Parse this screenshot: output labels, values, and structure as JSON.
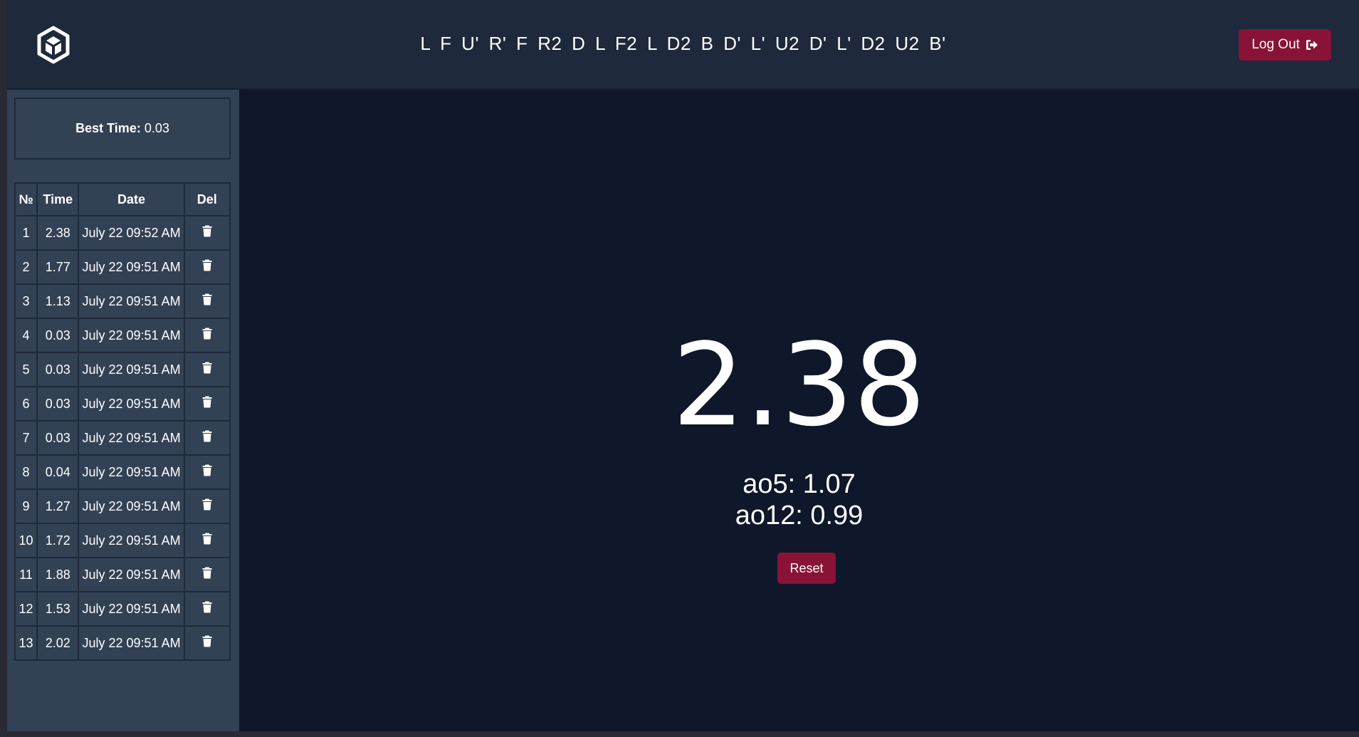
{
  "header": {
    "scramble": "L F U' R' F R2 D L F2 L D2 B D' L' U2 D' L' D2 U2 B'",
    "logout_label": "Log Out"
  },
  "sidebar": {
    "best_label": "Best Time:",
    "best_value": "0.03",
    "table": {
      "headers": [
        "№",
        "Time",
        "Date",
        "Del"
      ],
      "rows": [
        {
          "n": "1",
          "time": "2.38",
          "date": "July 22 09:52 AM"
        },
        {
          "n": "2",
          "time": "1.77",
          "date": "July 22 09:51 AM"
        },
        {
          "n": "3",
          "time": "1.13",
          "date": "July 22 09:51 AM"
        },
        {
          "n": "4",
          "time": "0.03",
          "date": "July 22 09:51 AM"
        },
        {
          "n": "5",
          "time": "0.03",
          "date": "July 22 09:51 AM"
        },
        {
          "n": "6",
          "time": "0.03",
          "date": "July 22 09:51 AM"
        },
        {
          "n": "7",
          "time": "0.03",
          "date": "July 22 09:51 AM"
        },
        {
          "n": "8",
          "time": "0.04",
          "date": "July 22 09:51 AM"
        },
        {
          "n": "9",
          "time": "1.27",
          "date": "July 22 09:51 AM"
        },
        {
          "n": "10",
          "time": "1.72",
          "date": "July 22 09:51 AM"
        },
        {
          "n": "11",
          "time": "1.88",
          "date": "July 22 09:51 AM"
        },
        {
          "n": "12",
          "time": "1.53",
          "date": "July 22 09:51 AM"
        },
        {
          "n": "13",
          "time": "2.02",
          "date": "July 22 09:51 AM"
        }
      ]
    }
  },
  "main": {
    "timer": "2.38",
    "ao5": "ao5: 1.07",
    "ao12": "ao12: 0.99",
    "reset_label": "Reset"
  },
  "colors": {
    "header_bg": "#1e293b",
    "sidebar_bg": "#334155",
    "main_bg": "#0f172a",
    "accent": "#881337"
  },
  "icons": {
    "logo": "cube-logo-icon",
    "logout": "sign-out-icon",
    "delete": "trash-icon"
  }
}
